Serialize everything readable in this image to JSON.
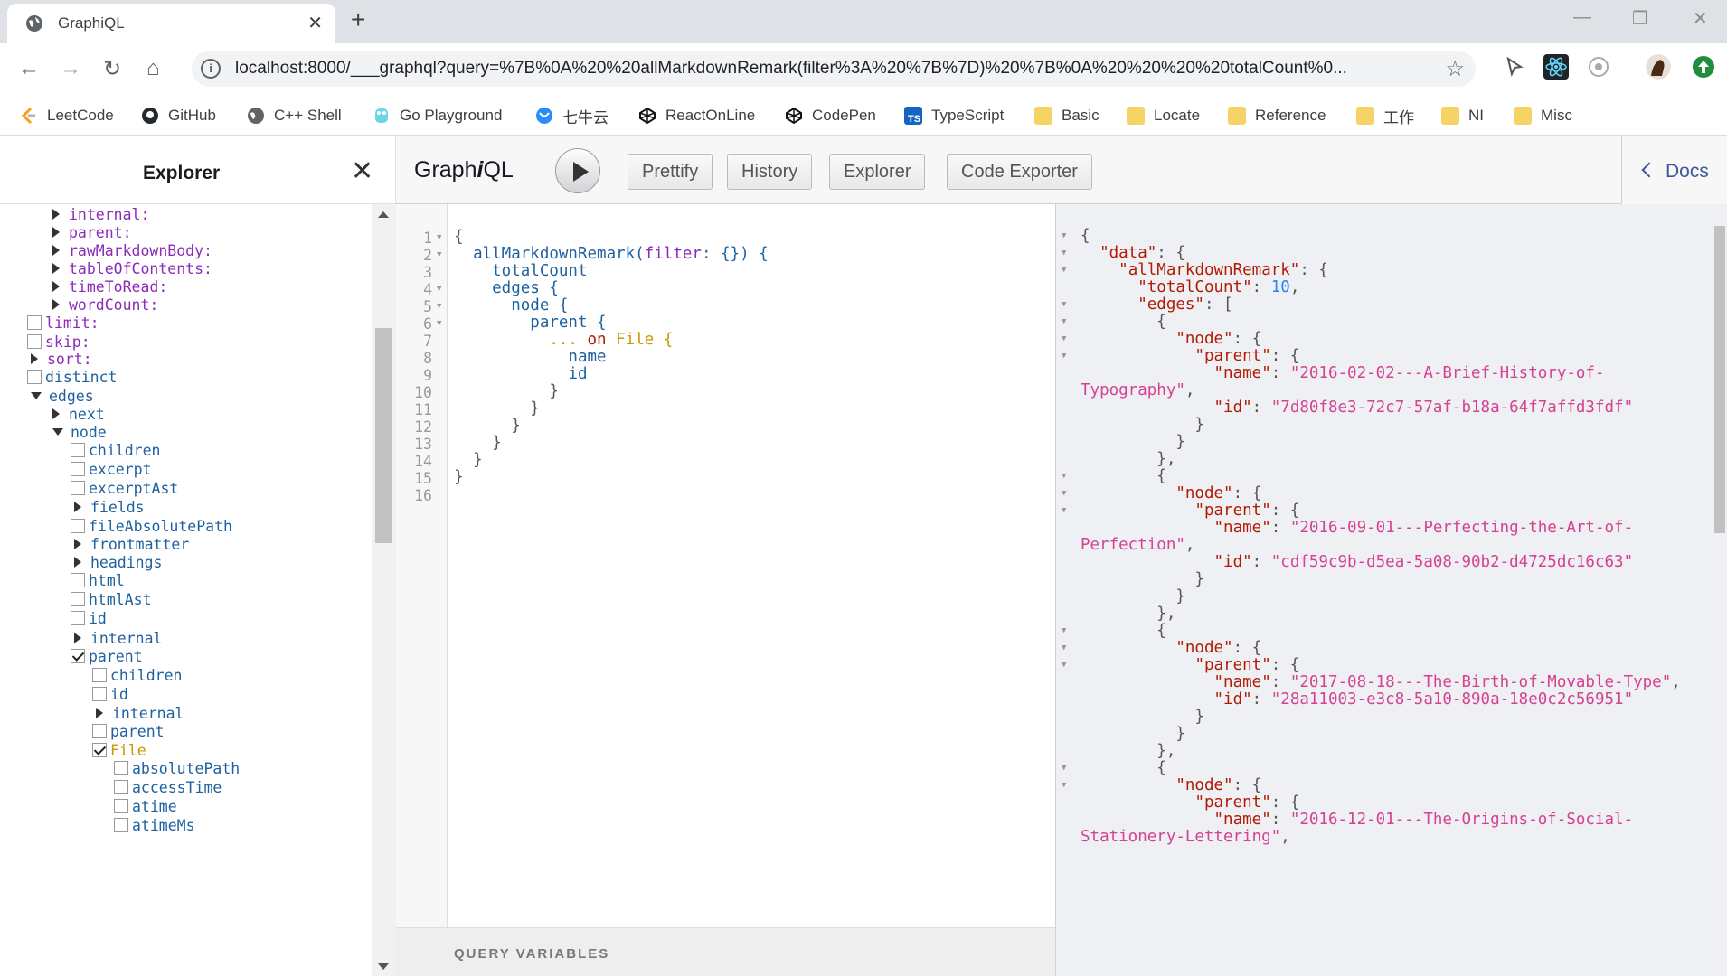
{
  "browser": {
    "tab_title": "GraphiQL",
    "url": "localhost:8000/___graphql?query=%7B%0A%20%20allMarkdownRemark(filter%3A%20%7B%7D)%20%7B%0A%20%20%20%20totalCount%0...",
    "bookmarks": [
      {
        "label": "LeetCode",
        "icon": "leetcode-icon"
      },
      {
        "label": "GitHub",
        "icon": "github-icon"
      },
      {
        "label": "C++ Shell",
        "icon": "globe-icon"
      },
      {
        "label": "Go Playground",
        "icon": "gopher-icon"
      },
      {
        "label": "七牛云",
        "icon": "qiniu-icon"
      },
      {
        "label": "ReactOnLine",
        "icon": "codepen-icon"
      },
      {
        "label": "CodePen",
        "icon": "codepen-icon"
      },
      {
        "label": "TypeScript",
        "icon": "ts-icon"
      },
      {
        "label": "Basic",
        "icon": "folder-icon"
      },
      {
        "label": "Locate",
        "icon": "folder-icon"
      },
      {
        "label": "Reference",
        "icon": "folder-icon"
      },
      {
        "label": "工作",
        "icon": "folder-icon"
      },
      {
        "label": "NI",
        "icon": "folder-icon"
      },
      {
        "label": "Misc",
        "icon": "folder-icon"
      }
    ]
  },
  "explorer": {
    "title": "Explorer",
    "items": [
      {
        "label": "internal:",
        "kind": "arg",
        "control": "collapsed"
      },
      {
        "label": "parent:",
        "kind": "arg",
        "control": "collapsed"
      },
      {
        "label": "rawMarkdownBody:",
        "kind": "arg",
        "control": "collapsed"
      },
      {
        "label": "tableOfContents:",
        "kind": "arg",
        "control": "collapsed"
      },
      {
        "label": "timeToRead:",
        "kind": "arg",
        "control": "collapsed"
      },
      {
        "label": "wordCount:",
        "kind": "arg",
        "control": "collapsed"
      },
      {
        "label": "limit:",
        "kind": "arg",
        "control": "unchecked"
      },
      {
        "label": "skip:",
        "kind": "arg",
        "control": "unchecked"
      },
      {
        "label": "sort:",
        "kind": "arg",
        "control": "collapsed"
      },
      {
        "label": "distinct",
        "kind": "field",
        "control": "unchecked"
      },
      {
        "label": "edges",
        "kind": "field",
        "control": "expanded"
      },
      {
        "label": "next",
        "kind": "field",
        "control": "collapsed"
      },
      {
        "label": "node",
        "kind": "field",
        "control": "expanded"
      },
      {
        "label": "children",
        "kind": "field",
        "control": "unchecked"
      },
      {
        "label": "excerpt",
        "kind": "field",
        "control": "unchecked"
      },
      {
        "label": "excerptAst",
        "kind": "field",
        "control": "unchecked"
      },
      {
        "label": "fields",
        "kind": "field",
        "control": "collapsed"
      },
      {
        "label": "fileAbsolutePath",
        "kind": "field",
        "control": "unchecked"
      },
      {
        "label": "frontmatter",
        "kind": "field",
        "control": "collapsed"
      },
      {
        "label": "headings",
        "kind": "field",
        "control": "collapsed"
      },
      {
        "label": "html",
        "kind": "field",
        "control": "unchecked"
      },
      {
        "label": "htmlAst",
        "kind": "field",
        "control": "unchecked"
      },
      {
        "label": "id",
        "kind": "field",
        "control": "unchecked"
      },
      {
        "label": "internal",
        "kind": "field",
        "control": "collapsed"
      },
      {
        "label": "parent",
        "kind": "field",
        "control": "checked"
      },
      {
        "label": "children",
        "kind": "field",
        "control": "unchecked"
      },
      {
        "label": "id",
        "kind": "field",
        "control": "unchecked"
      },
      {
        "label": "internal",
        "kind": "field",
        "control": "collapsed"
      },
      {
        "label": "parent",
        "kind": "field",
        "control": "unchecked"
      },
      {
        "label": "File",
        "kind": "type",
        "control": "checked"
      },
      {
        "label": "absolutePath",
        "kind": "field",
        "control": "unchecked"
      },
      {
        "label": "accessTime",
        "kind": "field",
        "control": "unchecked"
      },
      {
        "label": "atime",
        "kind": "field",
        "control": "unchecked"
      },
      {
        "label": "atimeMs",
        "kind": "field",
        "control": "unchecked"
      }
    ]
  },
  "toolbar": {
    "logo_prefix": "Graph",
    "logo_i": "i",
    "logo_suffix": "QL",
    "prettify": "Prettify",
    "history": "History",
    "explorer": "Explorer",
    "code_exporter": "Code Exporter",
    "docs": "Docs"
  },
  "editor": {
    "line_numbers": [
      "1",
      "2",
      "3",
      "4",
      "5",
      "6",
      "7",
      "8",
      "9",
      "10",
      "11",
      "12",
      "13",
      "14",
      "15",
      "16"
    ],
    "lines": [
      "{",
      "  allMarkdownRemark(filter: {}) {",
      "    totalCount",
      "    edges {",
      "      node {",
      "        parent {",
      "          ... on File {",
      "            name",
      "            id",
      "          }",
      "        }",
      "      }",
      "    }",
      "  }",
      "}",
      ""
    ],
    "query_variables_label": "QUERY VARIABLES"
  },
  "result": {
    "lines": [
      "{",
      "  \"data\": {",
      "    \"allMarkdownRemark\": {",
      "      \"totalCount\": 10,",
      "      \"edges\": [",
      "        {",
      "          \"node\": {",
      "            \"parent\": {",
      "              \"name\": \"2016-02-02---A-Brief-History-of-",
      "Typography\",",
      "              \"id\": \"7d80f8e3-72c7-57af-b18a-64f7affd3fdf\"",
      "            }",
      "          }",
      "        },",
      "        {",
      "          \"node\": {",
      "            \"parent\": {",
      "              \"name\": \"2016-09-01---Perfecting-the-Art-of-",
      "Perfection\",",
      "              \"id\": \"cdf59c9b-d5ea-5a08-90b2-d4725dc16c63\"",
      "            }",
      "          }",
      "        },",
      "        {",
      "          \"node\": {",
      "            \"parent\": {",
      "              \"name\": \"2017-08-18---The-Birth-of-Movable-Type\",",
      "              \"id\": \"28a11003-e3c8-5a10-890a-18e0c2c56951\"",
      "            }",
      "          }",
      "        },",
      "        {",
      "          \"node\": {",
      "            \"parent\": {",
      "              \"name\": \"2016-12-01---The-Origins-of-Social-",
      "Stationery-Lettering\","
    ]
  }
}
